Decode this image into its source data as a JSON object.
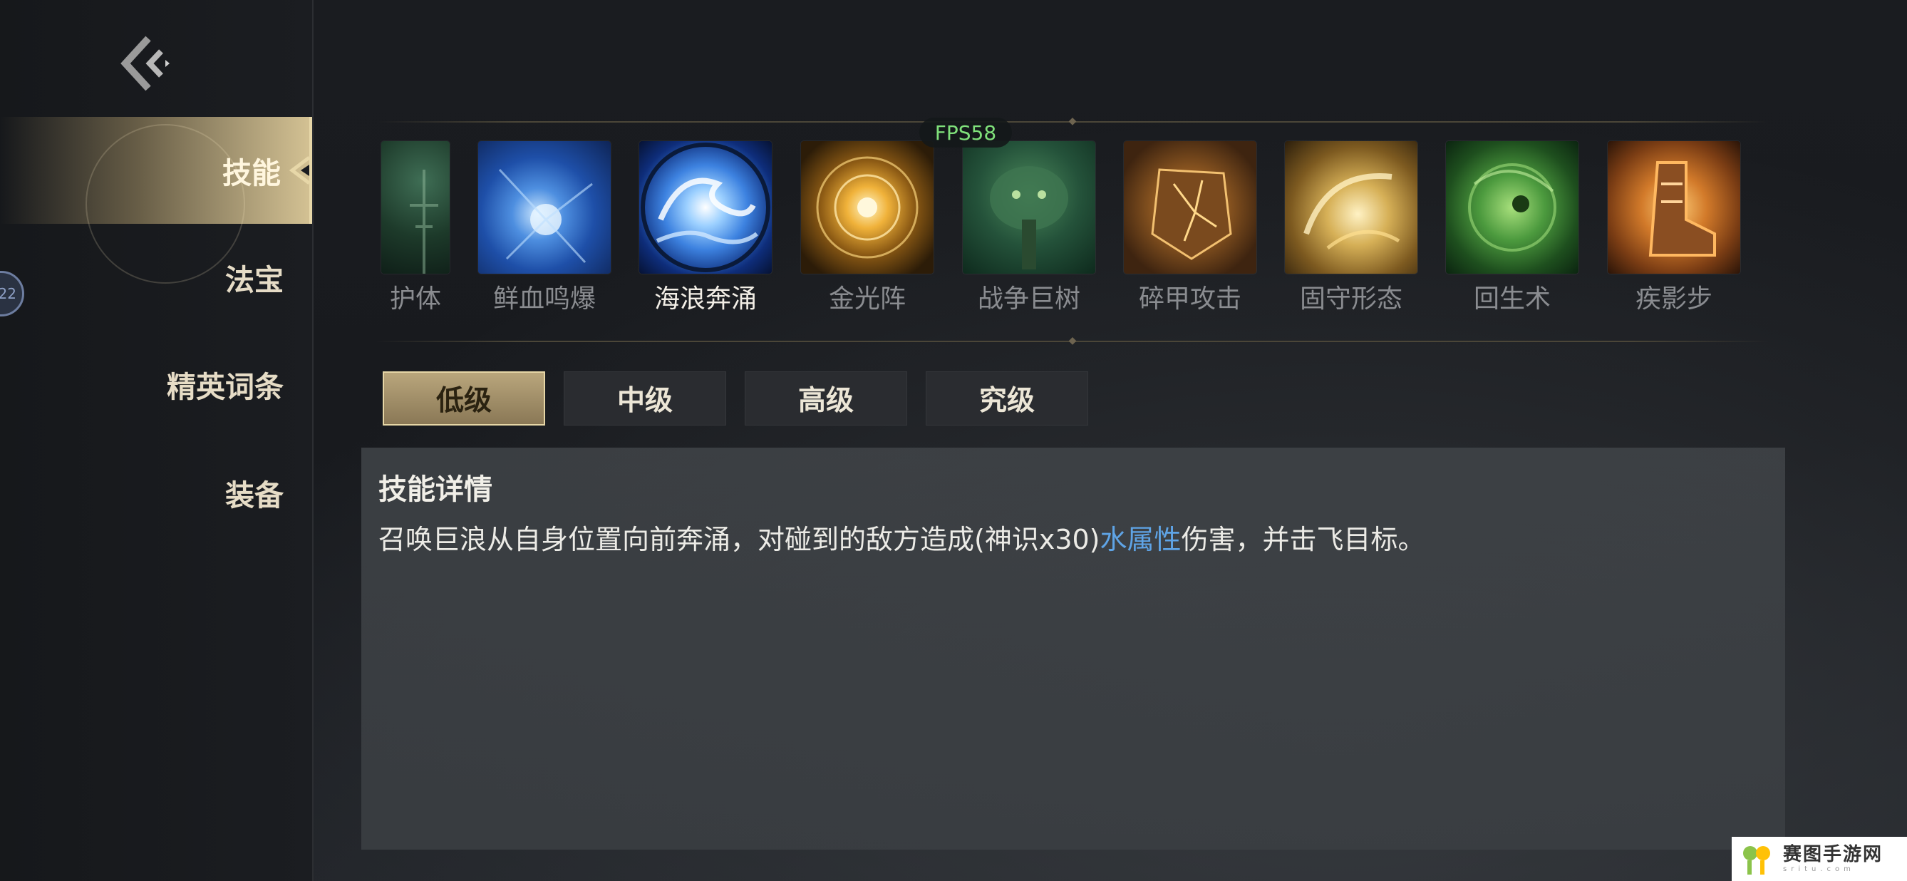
{
  "sidebar": {
    "items": [
      {
        "label": "技能",
        "active": true
      },
      {
        "label": "法宝",
        "active": false
      },
      {
        "label": "精英词条",
        "active": false
      },
      {
        "label": "装备",
        "active": false
      }
    ],
    "badge_text": "22"
  },
  "overlay": {
    "fps": "FPS58"
  },
  "skills": [
    {
      "name": "护体",
      "icon": "shield-body-icon"
    },
    {
      "name": "鲜血鸣爆",
      "icon": "blood-burst-icon"
    },
    {
      "name": "海浪奔涌",
      "icon": "ocean-wave-icon",
      "selected": true
    },
    {
      "name": "金光阵",
      "icon": "golden-array-icon"
    },
    {
      "name": "战争巨树",
      "icon": "war-tree-icon"
    },
    {
      "name": "碎甲攻击",
      "icon": "armor-break-icon"
    },
    {
      "name": "固守形态",
      "icon": "guard-stance-icon"
    },
    {
      "name": "回生术",
      "icon": "revive-icon"
    },
    {
      "name": "疾影步",
      "icon": "swift-step-icon"
    }
  ],
  "levels": [
    {
      "label": "低级",
      "active": true
    },
    {
      "label": "中级",
      "active": false
    },
    {
      "label": "高级",
      "active": false
    },
    {
      "label": "究级",
      "active": false
    }
  ],
  "detail": {
    "title": "技能详情",
    "text_before": "召唤巨浪从自身位置向前奔涌，对碰到的敌方造成(神识x30)",
    "highlight": "水属性",
    "text_after": "伤害，并击飞目标。"
  },
  "watermark": {
    "main": "赛图手游网",
    "sub": "sritu.com"
  },
  "colors": {
    "accent_gold": "#d3c193",
    "highlight_blue": "#5fa4e6",
    "fps_green": "#7fe07a"
  }
}
